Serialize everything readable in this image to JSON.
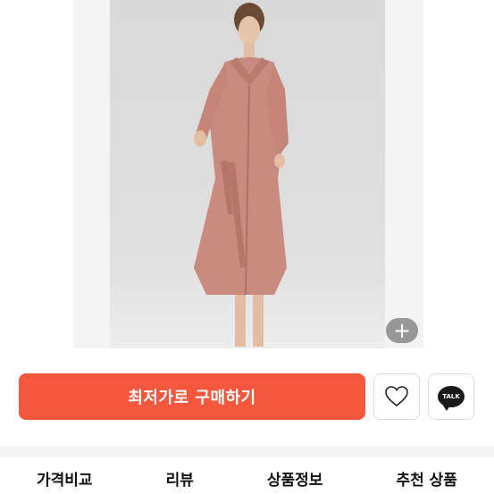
{
  "product": {
    "image_icon": "dress-photo",
    "zoom_label": "+"
  },
  "actions": {
    "buy_label": "최저가로 구매하기",
    "wish_icon": "heart-icon",
    "talk_label": "TALK"
  },
  "tabs": [
    {
      "label": "가격비교"
    },
    {
      "label": "리뷰"
    },
    {
      "label": "상품정보"
    },
    {
      "label": "추천 상품"
    }
  ],
  "colors": {
    "accent": "#f4573c",
    "dress": "#c98a80"
  }
}
